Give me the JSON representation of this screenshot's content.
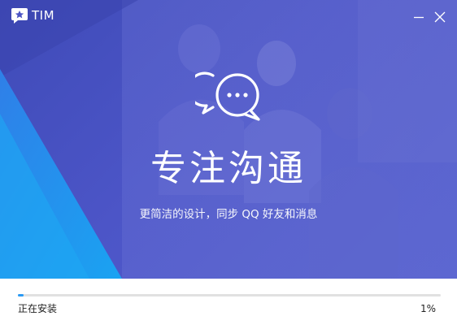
{
  "window": {
    "title": "TIM",
    "minimize_icon": "minimize-icon",
    "close_icon": "close-icon"
  },
  "banner": {
    "icon": "chat-bubbles-icon",
    "headline": "专注沟通",
    "subline": "更简洁的设计，同步 QQ 好友和消息"
  },
  "install": {
    "status": "正在安装",
    "percent_label": "1%",
    "progress": 0.01
  },
  "colors": {
    "banner_blue": "#4b54c4",
    "accent_cyan": "#1f9cf0",
    "progress_fill": "#2a9af4"
  }
}
